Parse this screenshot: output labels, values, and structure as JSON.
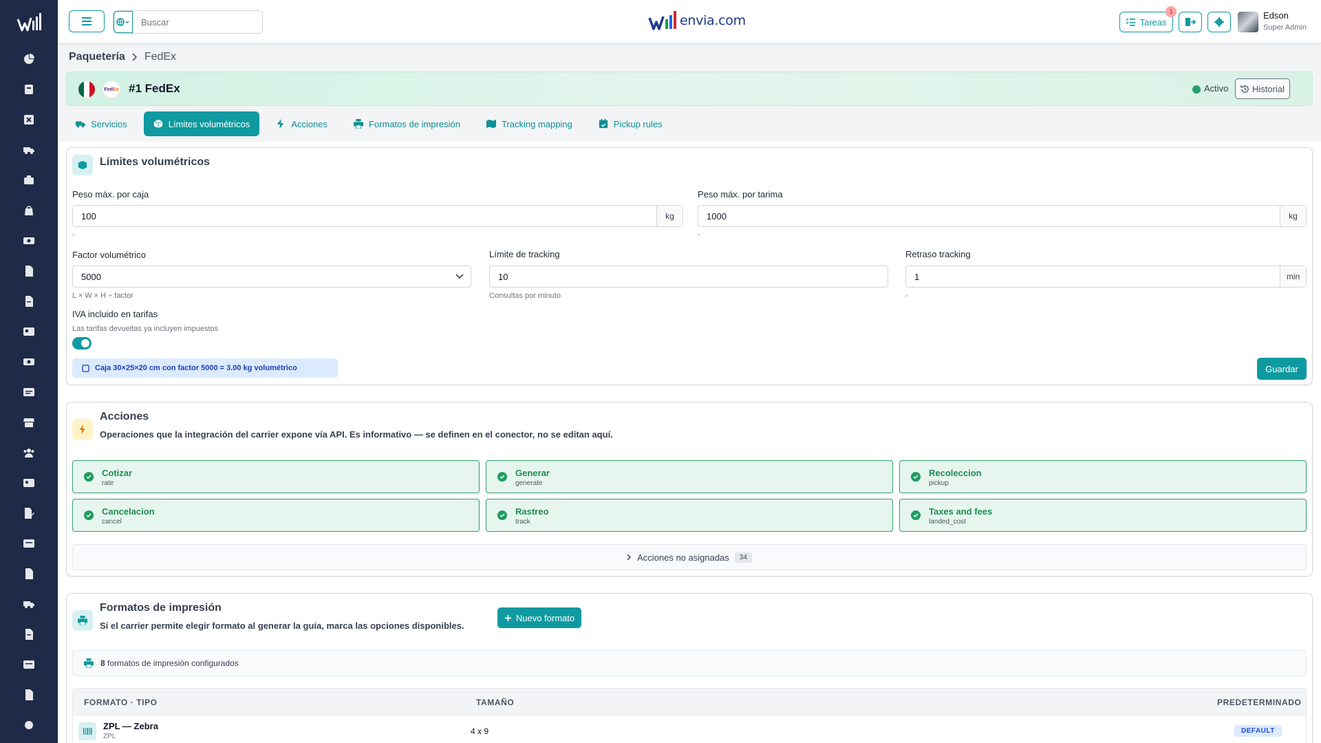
{
  "topbar": {
    "search_placeholder": "Buscar",
    "brand": "envia.com",
    "tasks_label": "Tareas",
    "tasks_badge": "1",
    "user_name": "Edson",
    "user_role": "Super Admin"
  },
  "breadcrumb": {
    "root": "Paquetería",
    "current": "FedEx"
  },
  "carrier": {
    "title": "#1 FedEx",
    "logo_fe": "Fed",
    "logo_ex": "Ex",
    "status": "Activo",
    "history_label": "Historial"
  },
  "tabs": [
    {
      "label": "Servicios"
    },
    {
      "label": "Límites volumétricos"
    },
    {
      "label": "Acciones"
    },
    {
      "label": "Formatos de impresión"
    },
    {
      "label": "Tracking mapping"
    },
    {
      "label": "Pickup rules"
    }
  ],
  "limits": {
    "title": "Límites volumétricos",
    "max_box_label": "Peso máx. por caja",
    "max_box_value": "100",
    "max_box_unit": "kg",
    "max_box_hint": "-",
    "max_pallet_label": "Peso máx. por tarima",
    "max_pallet_value": "1000",
    "max_pallet_unit": "kg",
    "max_pallet_hint": "-",
    "vol_factor_label": "Factor volumétrico",
    "vol_factor_value": "5000",
    "vol_factor_hint": "L × W × H ÷ factor",
    "tracking_limit_label": "Límite de tracking",
    "tracking_limit_value": "10",
    "tracking_limit_hint": "Consultas por minuto",
    "tracking_delay_label": "Retraso tracking",
    "tracking_delay_value": "1",
    "tracking_delay_unit": "min",
    "tracking_delay_hint": "-",
    "iva_label": "IVA incluido en tarifas",
    "iva_hint": "Las tarifas devueltas ya incluyen impuestos",
    "iva_enabled": true,
    "calc_note": "Caja 30×25×20 cm con factor 5000 = 3.00 kg volumétrico",
    "save_label": "Guardar"
  },
  "actions": {
    "title": "Acciones",
    "subtitle": "Operaciones que la integración del carrier expone vía API. Es informativo — se definen en el conector, no se editan aquí.",
    "items": [
      {
        "name": "Cotizar",
        "code": "rate"
      },
      {
        "name": "Generar",
        "code": "generate"
      },
      {
        "name": "Recoleccion",
        "code": "pickup"
      },
      {
        "name": "Cancelacion",
        "code": "cancel"
      },
      {
        "name": "Rastreo",
        "code": "track"
      },
      {
        "name": "Taxes and fees",
        "code": "landed_cost"
      }
    ],
    "unassigned_label": "Acciones no asignadas",
    "unassigned_count": "34"
  },
  "formats": {
    "title": "Formatos de impresión",
    "subtitle": "Si el carrier permite elegir formato al generar la guía, marca las opciones disponibles.",
    "new_label": "Nuevo formato",
    "summary_count": "8",
    "summary_text": "formatos de impresión configurados",
    "col_format": "FORMATO · TIPO",
    "col_size": "TAMAÑO",
    "col_default": "PREDETERMINADO",
    "rows": [
      {
        "name": "ZPL — Zebra",
        "type": "ZPL",
        "size": "4 x 9",
        "default": "DEFAULT"
      }
    ]
  },
  "colors": {
    "accent": "#0e9aa0",
    "sidebar": "#1e2a47",
    "success": "#1f9d60"
  }
}
